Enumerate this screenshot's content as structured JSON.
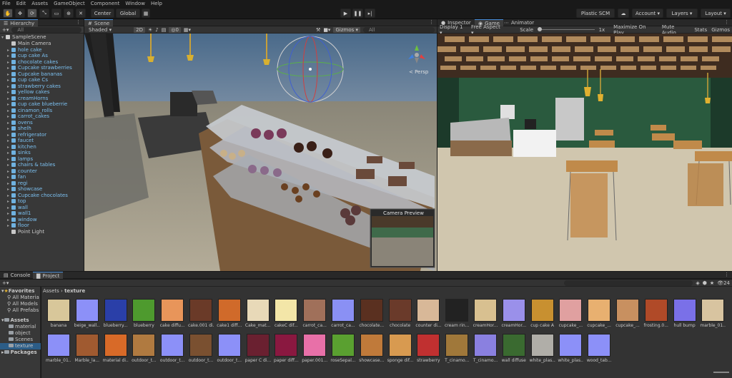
{
  "menu": [
    "File",
    "Edit",
    "Assets",
    "GameObject",
    "Component",
    "Window",
    "Help"
  ],
  "toolbar": {
    "center": "Center",
    "global": "Global",
    "plastic": "Plastic SCM",
    "account": "Account",
    "layers": "Layers",
    "layout": "Layout"
  },
  "hierarchy": {
    "tab": "Hierarchy",
    "search_placeholder": "All",
    "scene": "SampleScene",
    "items": [
      {
        "label": "Main Camera",
        "blue": false,
        "arrow": false
      },
      {
        "label": "hole cake",
        "blue": true,
        "arrow": true
      },
      {
        "label": "cup cake As",
        "blue": true,
        "arrow": true
      },
      {
        "label": "chocolate cakes",
        "blue": true,
        "arrow": true
      },
      {
        "label": "Cupcake strawberries",
        "blue": true,
        "arrow": true
      },
      {
        "label": "Cupcake bananas",
        "blue": true,
        "arrow": true
      },
      {
        "label": "cup cake Cs",
        "blue": true,
        "arrow": true
      },
      {
        "label": "strawberry cakes",
        "blue": true,
        "arrow": true
      },
      {
        "label": "yellow cakes",
        "blue": true,
        "arrow": true
      },
      {
        "label": "creamHorns",
        "blue": true,
        "arrow": true
      },
      {
        "label": "cup cake blueberrie",
        "blue": true,
        "arrow": true
      },
      {
        "label": "cinamon_rolls",
        "blue": true,
        "arrow": true
      },
      {
        "label": "carrot_cakes",
        "blue": true,
        "arrow": true
      },
      {
        "label": "ovens",
        "blue": true,
        "arrow": true
      },
      {
        "label": "shelh",
        "blue": true,
        "arrow": true
      },
      {
        "label": "refrigerator",
        "blue": true,
        "arrow": true
      },
      {
        "label": "faucet",
        "blue": true,
        "arrow": true
      },
      {
        "label": "kitchen",
        "blue": true,
        "arrow": true
      },
      {
        "label": "sinks",
        "blue": true,
        "arrow": true
      },
      {
        "label": "lamps",
        "blue": true,
        "arrow": true
      },
      {
        "label": "chairs & tables",
        "blue": true,
        "arrow": true
      },
      {
        "label": "counter",
        "blue": true,
        "arrow": true
      },
      {
        "label": "fan",
        "blue": true,
        "arrow": true
      },
      {
        "label": "regi",
        "blue": true,
        "arrow": true
      },
      {
        "label": "showcase",
        "blue": true,
        "arrow": true
      },
      {
        "label": "Cupcake chocolates",
        "blue": true,
        "arrow": true
      },
      {
        "label": "top",
        "blue": true,
        "arrow": true
      },
      {
        "label": "wall",
        "blue": true,
        "arrow": true
      },
      {
        "label": "wall1",
        "blue": true,
        "arrow": true
      },
      {
        "label": "window",
        "blue": true,
        "arrow": true
      },
      {
        "label": "floor",
        "blue": true,
        "arrow": true
      },
      {
        "label": "Point Light",
        "blue": false,
        "arrow": false
      }
    ]
  },
  "scene": {
    "tab": "Scene",
    "shading": "Shaded",
    "mode2d": "2D",
    "layers_count": "0",
    "gizmos": "Gizmos",
    "search_placeholder": "All",
    "persp": "< Persp",
    "camera_preview": "Camera Preview"
  },
  "game": {
    "tab_inspector": "Inspector",
    "tab_game": "Game",
    "tab_animator": "Animator",
    "display": "Display 1",
    "aspect": "Free Aspect",
    "scale_label": "Scale",
    "scale_value": "1x",
    "maximize": "Maximize On Play",
    "mute": "Mute Audio",
    "stats": "Stats",
    "gizmos": "Gizmos"
  },
  "project": {
    "tab_console": "Console",
    "tab_project": "Project",
    "breadcrumb_root": "Assets",
    "breadcrumb_sep": "›",
    "breadcrumb_leaf": "texture",
    "badge": "24",
    "tree": {
      "favorites": "Favorites",
      "fav_items": [
        "All Materia",
        "All Models",
        "All Prefabs"
      ],
      "assets": "Assets",
      "asset_items": [
        "material",
        "object",
        "Scenes",
        "texture"
      ],
      "packages": "Packages"
    },
    "assets_row1": [
      {
        "label": "banana",
        "color": "#d8c79a"
      },
      {
        "label": "beige_wall...",
        "color": "#8c90f8"
      },
      {
        "label": "blueberry...",
        "color": "#2a3fa8"
      },
      {
        "label": "blueberry",
        "color": "#4e9a2e"
      },
      {
        "label": "cake diffu...",
        "color": "#e8955a"
      },
      {
        "label": "cake.001 di...",
        "color": "#6a3a28"
      },
      {
        "label": "cake1 diff...",
        "color": "#d06a2a"
      },
      {
        "label": "Cake_mat...",
        "color": "#e8d9b8"
      },
      {
        "label": "cakeC dif...",
        "color": "#f3e6a8"
      },
      {
        "label": "carrot_ca...",
        "color": "#a0705a"
      },
      {
        "label": "carrot_ca...",
        "color": "#8a90f4"
      },
      {
        "label": "chocolate...",
        "color": "#5a3020"
      },
      {
        "label": "chocolate",
        "color": "#6a3a2a"
      },
      {
        "label": "counter di...",
        "color": "#d8b898"
      },
      {
        "label": "cream rin...",
        "color": "#222222"
      },
      {
        "label": "creamHor...",
        "color": "#d8c090"
      },
      {
        "label": "creamHor...",
        "color": "#9a90ea"
      },
      {
        "label": "cup cake A",
        "color": "#c89030"
      },
      {
        "label": "cupcake_...",
        "color": "#e0a0a0"
      },
      {
        "label": "cupcake_...",
        "color": "#e8b070"
      },
      {
        "label": "cupcake_...",
        "color": "#c89060"
      },
      {
        "label": "frosting.0...",
        "color": "#b04a28"
      },
      {
        "label": "hull bump",
        "color": "#7a70e8"
      },
      {
        "label": "marble_01...",
        "color": "#d8c4a0"
      }
    ],
    "assets_row2": [
      {
        "label": "marble_01...",
        "color": "#8c90f8"
      },
      {
        "label": "Marble_la...",
        "color": "#a05a30"
      },
      {
        "label": "material di...",
        "color": "#d86a28"
      },
      {
        "label": "outdoor_t...",
        "color": "#b07a40"
      },
      {
        "label": "outdoor_t...",
        "color": "#8c90f8"
      },
      {
        "label": "outdoor_t...",
        "color": "#7a5030"
      },
      {
        "label": "outdoor_t...",
        "color": "#8c90f8"
      },
      {
        "label": "paper C di...",
        "color": "#6a2030"
      },
      {
        "label": "paper diff...",
        "color": "#8a1840"
      },
      {
        "label": "paper.001...",
        "color": "#e870a8"
      },
      {
        "label": "roseSepal...",
        "color": "#5aa030"
      },
      {
        "label": "showcase...",
        "color": "#c07a3a"
      },
      {
        "label": "sponge dif...",
        "color": "#d89a50"
      },
      {
        "label": "strawberry",
        "color": "#c03030"
      },
      {
        "label": "T_cinamo...",
        "color": "#a0783a"
      },
      {
        "label": "T_cinamo...",
        "color": "#8a80e0"
      },
      {
        "label": "wall diffuse",
        "color": "#3a6a30"
      },
      {
        "label": "white_plas...",
        "color": "#b0aea8"
      },
      {
        "label": "white_plas...",
        "color": "#8c90f8"
      },
      {
        "label": "wood_tab...",
        "color": "#8c90f8"
      }
    ]
  }
}
